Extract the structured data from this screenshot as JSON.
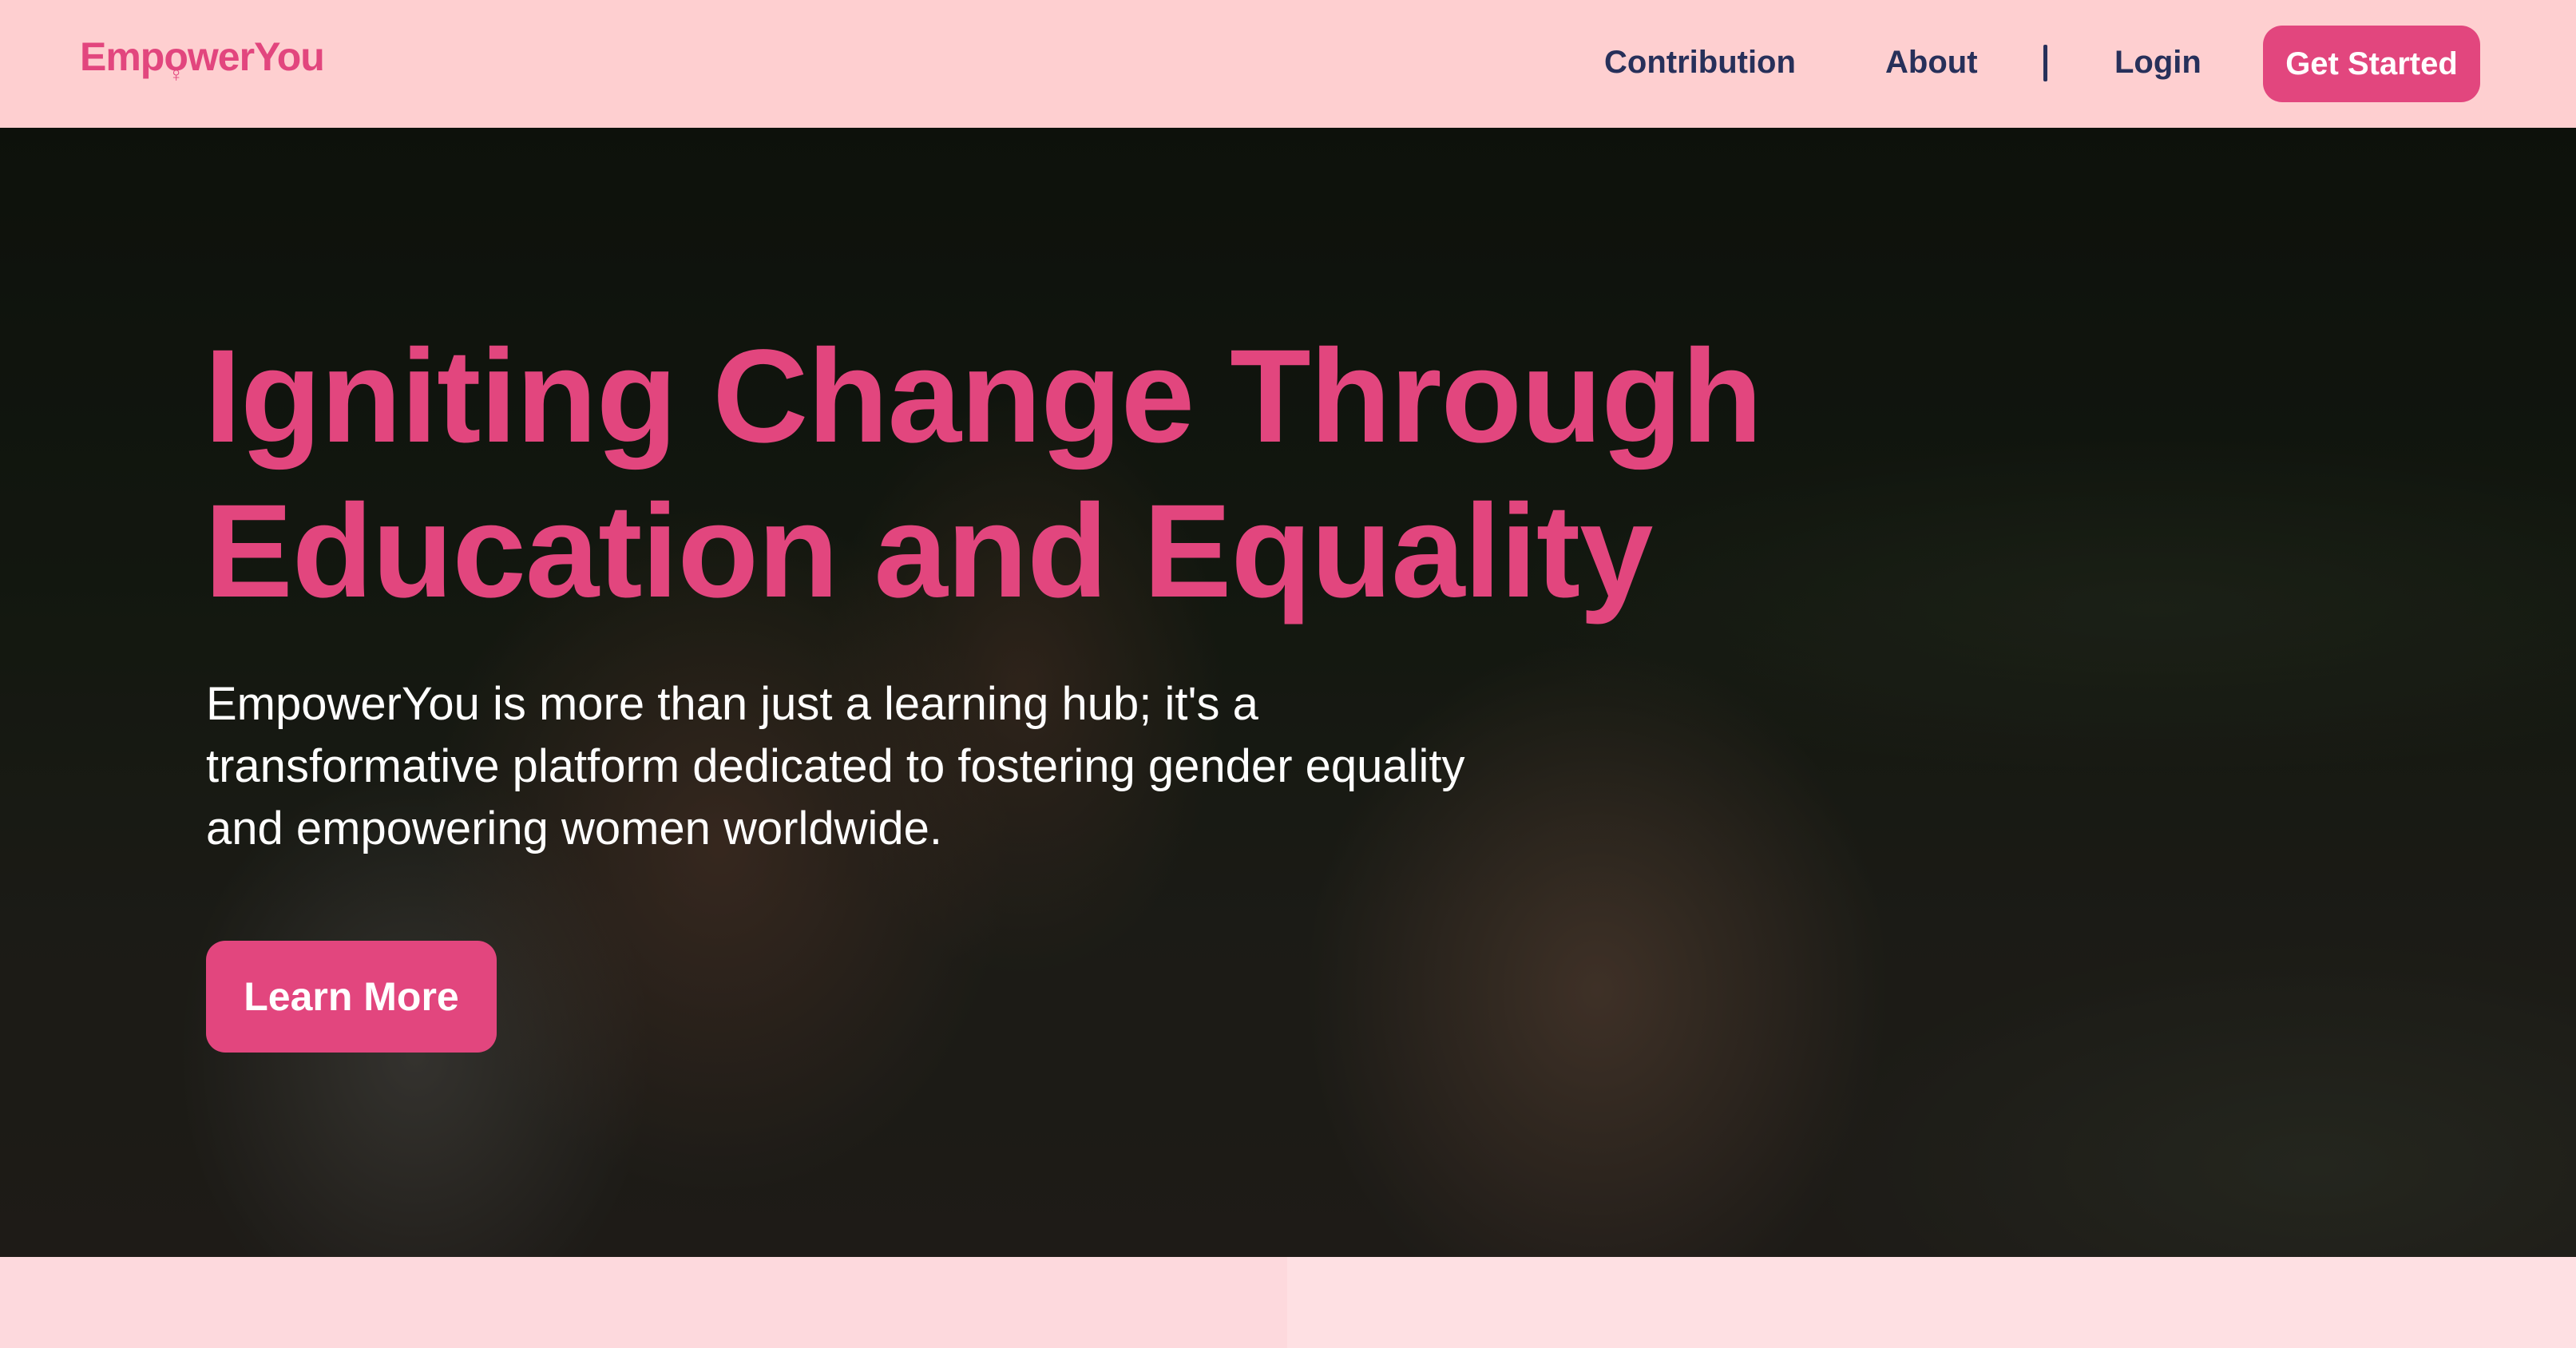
{
  "brand": {
    "name_prefix": "Emp",
    "name_o": "o",
    "name_suffix": "werYou",
    "symbol": "♀",
    "color": "#e2467e"
  },
  "nav": {
    "links": [
      {
        "label": "Contribution"
      },
      {
        "label": "About"
      },
      {
        "label": "Login"
      }
    ],
    "cta_label": "Get Started"
  },
  "hero": {
    "title": "Igniting Change Through Education and Equality",
    "subtitle": "EmpowerYou is more than just a learning hub; it's a transformative platform dedicated to fostering gender equality and empowering women worldwide.",
    "button_label": "Learn More"
  },
  "colors": {
    "accent": "#e2467e",
    "navbar_bg": "#fecfd0",
    "nav_text": "#27305a",
    "footer_bg": "#fee0e3"
  }
}
